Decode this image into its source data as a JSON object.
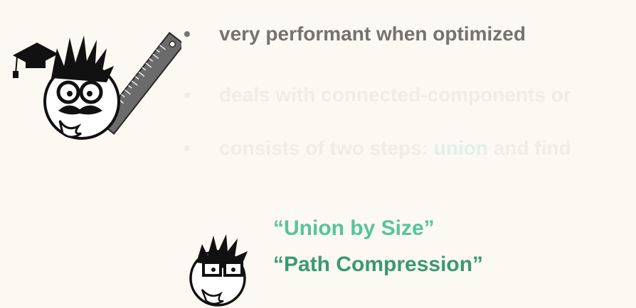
{
  "bullets": [
    {
      "text": "very performant when optimized"
    },
    {
      "text": "deals with connected-components or"
    },
    {
      "text_before": "consists of two steps: ",
      "highlight": "union",
      "text_after": " and find"
    }
  ],
  "quotes": [
    "“Union by Size”",
    "“Path Compression”"
  ],
  "colors": {
    "background": "#fcf8f2",
    "active_bullet": "#757270",
    "faded_bullet": "#f1ece6",
    "quote_1": "#56c49a",
    "quote_2": "#3a9970"
  }
}
